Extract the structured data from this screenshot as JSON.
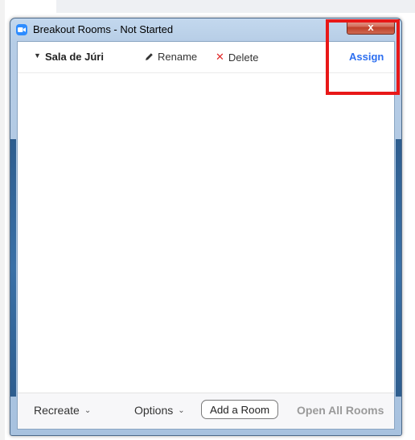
{
  "window": {
    "title": "Breakout Rooms - Not Started",
    "close_label": "x"
  },
  "room": {
    "name": "Sala de Júri",
    "rename_label": "Rename",
    "delete_label": "Delete",
    "assign_label": "Assign"
  },
  "footer": {
    "recreate_label": "Recreate",
    "options_label": "Options",
    "add_room_label": "Add a Room",
    "open_all_label": "Open All Rooms"
  },
  "icons": {
    "app": "zoom-camera-icon",
    "caret": "caret-down-icon",
    "rename": "pencil-icon",
    "delete": "x-icon",
    "chevron": "chevron-down-icon"
  },
  "colors": {
    "assign": "#2d6ff0",
    "delete_icon": "#e02828",
    "highlight": "#e81818",
    "app_icon": "#2d8cff"
  }
}
